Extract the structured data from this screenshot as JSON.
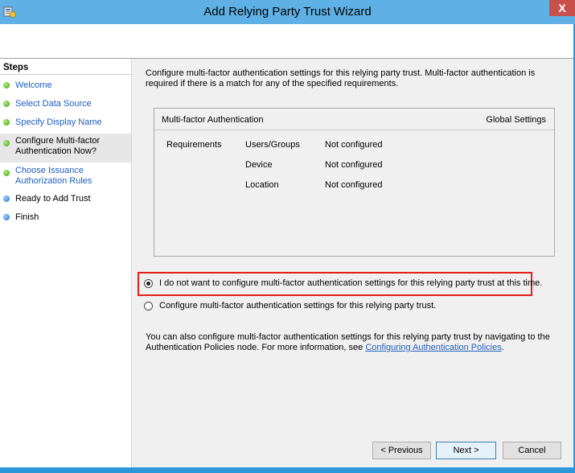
{
  "window": {
    "title": "Add Relying Party Trust Wizard",
    "close_glyph": "X",
    "icon": "adfs-wizard-icon",
    "accent_color": "#5fb1e5",
    "frame_color": "#2b97d8"
  },
  "steps": {
    "title": "Steps",
    "items": [
      {
        "label": "Welcome",
        "status": "done"
      },
      {
        "label": "Select Data Source",
        "status": "done"
      },
      {
        "label": "Specify Display Name",
        "status": "done"
      },
      {
        "label": "Configure Multi-factor Authentication Now?",
        "status": "current"
      },
      {
        "label": "Choose Issuance Authorization Rules",
        "status": "done"
      },
      {
        "label": "Ready to Add Trust",
        "status": "pending"
      },
      {
        "label": "Finish",
        "status": "pending"
      }
    ]
  },
  "main": {
    "description": "Configure multi-factor authentication settings for this relying party trust. Multi-factor authentication is required if there is a match for any of the specified requirements.",
    "mfa_table": {
      "header": "Multi-factor Authentication",
      "global_settings": "Global Settings",
      "requirements_label": "Requirements",
      "rows": [
        {
          "name": "Users/Groups",
          "value": "Not configured"
        },
        {
          "name": "Device",
          "value": "Not configured"
        },
        {
          "name": "Location",
          "value": "Not configured"
        }
      ]
    },
    "options": [
      {
        "label": "I do not want to configure multi-factor authentication settings for this relying party trust at this time.",
        "checked": true
      },
      {
        "label": "Configure multi-factor authentication settings for this relying party trust.",
        "checked": false
      }
    ],
    "info_text": "You can also configure multi-factor authentication settings for this relying party trust by navigating to the Authentication Policies node. For more information, see",
    "info_link": "Configuring Authentication Policies",
    "info_suffix": "."
  },
  "buttons": {
    "previous": "< Previous",
    "next": "Next >",
    "cancel": "Cancel"
  }
}
